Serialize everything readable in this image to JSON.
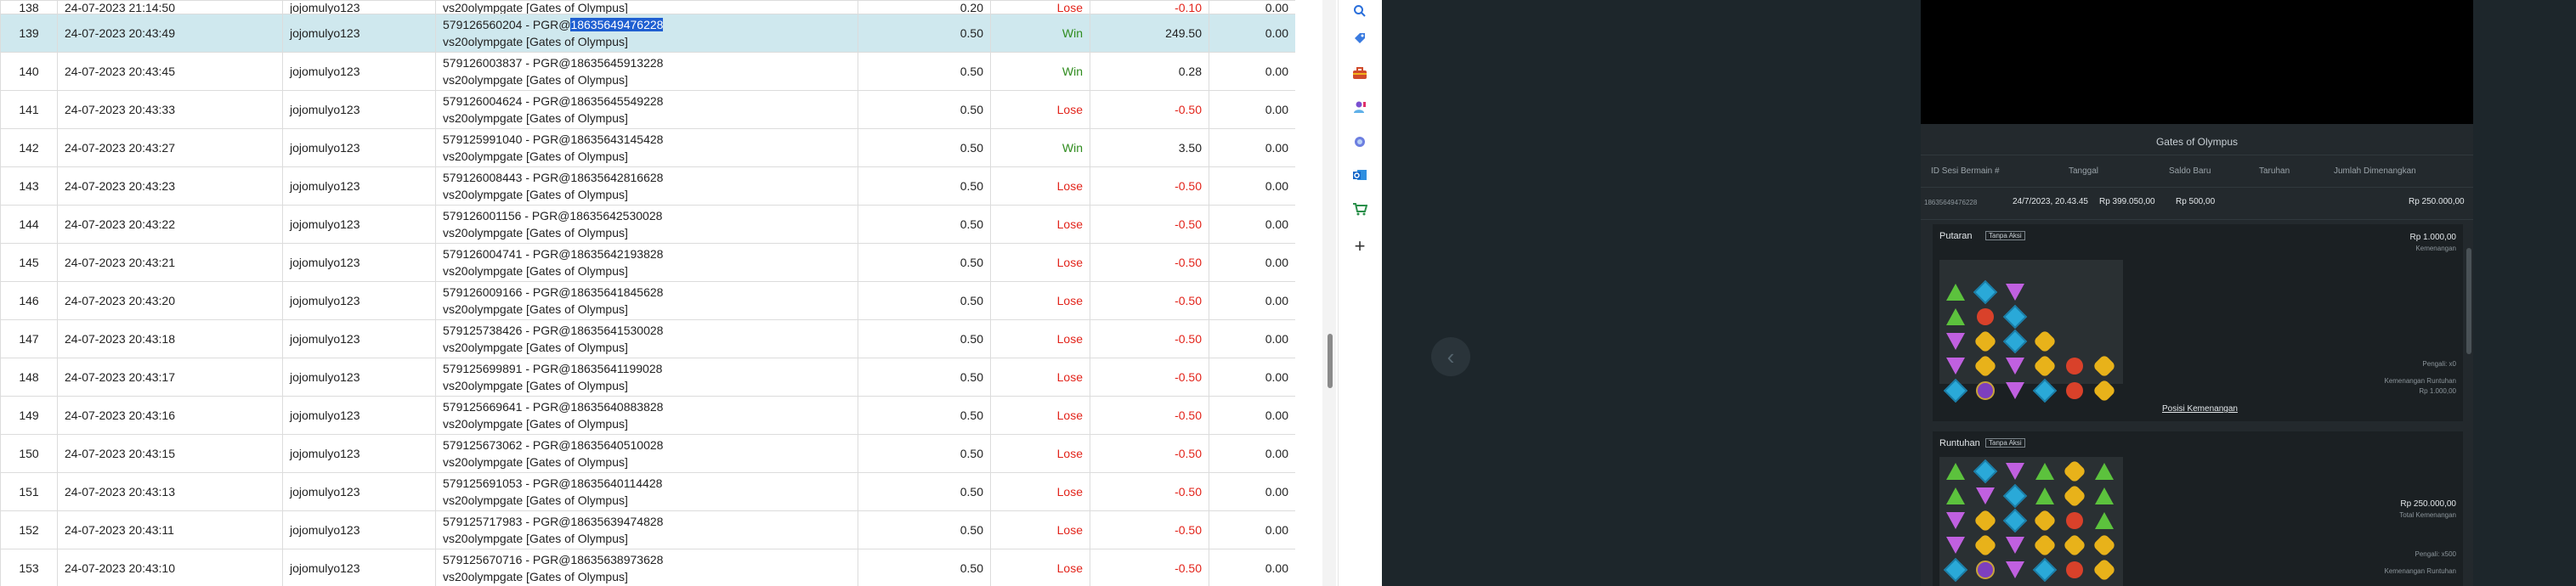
{
  "table": {
    "partial_top": {
      "no": "138",
      "date": "24-07-2023 21:14:50",
      "user": "jojomulyo123",
      "trans_line2": "vs20olympgate [Gates of Olympus]",
      "bet": "0.20",
      "status": "Lose",
      "win": "-0.10",
      "last": "0.00"
    },
    "rows": [
      {
        "no": "139",
        "date": "24-07-2023 20:43:49",
        "user": "jojomulyo123",
        "trans_prefix": "579126560204 - PGR@",
        "trans_hl": "18635649476228",
        "trans_line2": "vs20olympgate [Gates of Olympus]",
        "bet": "0.50",
        "status": "Win",
        "amount": "249.50",
        "last": "0.00",
        "selected": true
      },
      {
        "no": "140",
        "date": "24-07-2023 20:43:45",
        "user": "jojomulyo123",
        "trans_prefix": "579126003837 - PGR@18635645913228",
        "trans_hl": "",
        "trans_line2": "vs20olympgate [Gates of Olympus]",
        "bet": "0.50",
        "status": "Win",
        "amount": "0.28",
        "last": "0.00"
      },
      {
        "no": "141",
        "date": "24-07-2023 20:43:33",
        "user": "jojomulyo123",
        "trans_prefix": "579126004624 - PGR@18635645549228",
        "trans_hl": "",
        "trans_line2": "vs20olympgate [Gates of Olympus]",
        "bet": "0.50",
        "status": "Lose",
        "amount": "-0.50",
        "last": "0.00"
      },
      {
        "no": "142",
        "date": "24-07-2023 20:43:27",
        "user": "jojomulyo123",
        "trans_prefix": "579125991040 - PGR@18635643145428",
        "trans_hl": "",
        "trans_line2": "vs20olympgate [Gates of Olympus]",
        "bet": "0.50",
        "status": "Win",
        "amount": "3.50",
        "last": "0.00"
      },
      {
        "no": "143",
        "date": "24-07-2023 20:43:23",
        "user": "jojomulyo123",
        "trans_prefix": "579126008443 - PGR@18635642816628",
        "trans_hl": "",
        "trans_line2": "vs20olympgate [Gates of Olympus]",
        "bet": "0.50",
        "status": "Lose",
        "amount": "-0.50",
        "last": "0.00"
      },
      {
        "no": "144",
        "date": "24-07-2023 20:43:22",
        "user": "jojomulyo123",
        "trans_prefix": "579126001156 - PGR@18635642530028",
        "trans_hl": "",
        "trans_line2": "vs20olympgate [Gates of Olympus]",
        "bet": "0.50",
        "status": "Lose",
        "amount": "-0.50",
        "last": "0.00"
      },
      {
        "no": "145",
        "date": "24-07-2023 20:43:21",
        "user": "jojomulyo123",
        "trans_prefix": "579126004741 - PGR@18635642193828",
        "trans_hl": "",
        "trans_line2": "vs20olympgate [Gates of Olympus]",
        "bet": "0.50",
        "status": "Lose",
        "amount": "-0.50",
        "last": "0.00"
      },
      {
        "no": "146",
        "date": "24-07-2023 20:43:20",
        "user": "jojomulyo123",
        "trans_prefix": "579126009166 - PGR@18635641845628",
        "trans_hl": "",
        "trans_line2": "vs20olympgate [Gates of Olympus]",
        "bet": "0.50",
        "status": "Lose",
        "amount": "-0.50",
        "last": "0.00"
      },
      {
        "no": "147",
        "date": "24-07-2023 20:43:18",
        "user": "jojomulyo123",
        "trans_prefix": "579125738426 - PGR@18635641530028",
        "trans_hl": "",
        "trans_line2": "vs20olympgate [Gates of Olympus]",
        "bet": "0.50",
        "status": "Lose",
        "amount": "-0.50",
        "last": "0.00"
      },
      {
        "no": "148",
        "date": "24-07-2023 20:43:17",
        "user": "jojomulyo123",
        "trans_prefix": "579125699891 - PGR@18635641199028",
        "trans_hl": "",
        "trans_line2": "vs20olympgate [Gates of Olympus]",
        "bet": "0.50",
        "status": "Lose",
        "amount": "-0.50",
        "last": "0.00"
      },
      {
        "no": "149",
        "date": "24-07-2023 20:43:16",
        "user": "jojomulyo123",
        "trans_prefix": "579125669641 - PGR@18635640883828",
        "trans_hl": "",
        "trans_line2": "vs20olympgate [Gates of Olympus]",
        "bet": "0.50",
        "status": "Lose",
        "amount": "-0.50",
        "last": "0.00"
      },
      {
        "no": "150",
        "date": "24-07-2023 20:43:15",
        "user": "jojomulyo123",
        "trans_prefix": "579125673062 - PGR@18635640510028",
        "trans_hl": "",
        "trans_line2": "vs20olympgate [Gates of Olympus]",
        "bet": "0.50",
        "status": "Lose",
        "amount": "-0.50",
        "last": "0.00"
      },
      {
        "no": "151",
        "date": "24-07-2023 20:43:13",
        "user": "jojomulyo123",
        "trans_prefix": "579125691053 - PGR@18635640114428",
        "trans_hl": "",
        "trans_line2": "vs20olympgate [Gates of Olympus]",
        "bet": "0.50",
        "status": "Lose",
        "amount": "-0.50",
        "last": "0.00"
      },
      {
        "no": "152",
        "date": "24-07-2023 20:43:11",
        "user": "jojomulyo123",
        "trans_prefix": "579125717983 - PGR@18635639474828",
        "trans_hl": "",
        "trans_line2": "vs20olympgate [Gates of Olympus]",
        "bet": "0.50",
        "status": "Lose",
        "amount": "-0.50",
        "last": "0.00"
      },
      {
        "no": "153",
        "date": "24-07-2023 20:43:10",
        "user": "jojomulyo123",
        "trans_prefix": "579125670716 - PGR@18635638973628",
        "trans_hl": "",
        "trans_line2": "vs20olympgate [Gates of Olympus]",
        "bet": "0.50",
        "status": "Lose",
        "amount": "-0.50",
        "last": "0.00"
      }
    ]
  },
  "sidebar": {
    "icons": [
      "search-icon",
      "tag-icon",
      "toolbox-icon",
      "person-icon",
      "circle-app-icon",
      "outlook-icon",
      "shopping-cart-icon",
      "plus-icon"
    ]
  },
  "game": {
    "title": "Gates of Olympus",
    "headers": [
      "ID Sesi Bermain #",
      "Tanggal",
      "Saldo Baru",
      "Taruhan",
      "Jumlah Dimenangkan"
    ],
    "values": [
      "18635649476228",
      "24/7/2023, 20.43.45",
      "Rp 399.050,00",
      "Rp 500,00",
      "Rp 250.000,00"
    ],
    "card1": {
      "title": "Putaran",
      "tag": "Tanpa Aksi",
      "amount": "Rp 1.000,00",
      "amount_sub": "Kemenangan",
      "note1": "Pengali: x0",
      "note2": "Kemenangan Runtuhan",
      "note3": "Rp 1.000,00",
      "link": "Posisi Kemenangan"
    },
    "card2": {
      "title": "Runtuhan",
      "tag": "Tanpa Aksi",
      "amount": "Rp 250.000,00",
      "amount_sub": "Total Kemenangan",
      "note1": "Pengali: x500",
      "note2": "Kemenangan Runtuhan"
    }
  },
  "colors": {
    "win": "#2e8b1d",
    "lose": "#e2231a",
    "selected": "#cfe8ee",
    "highlight": "#1f5fd1",
    "panel": "#1d262b"
  }
}
